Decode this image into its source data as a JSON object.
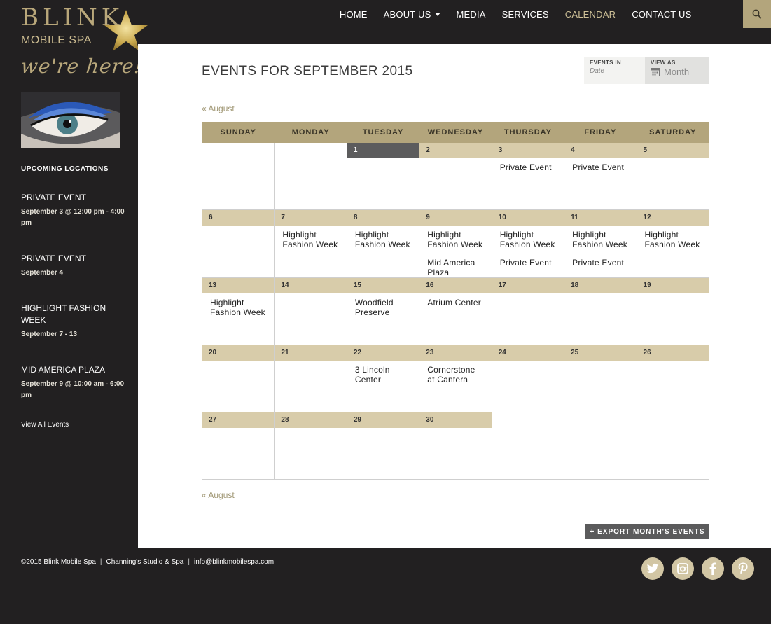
{
  "brand": {
    "logo_word": "BLINK",
    "logo_sub": "MOBILE SPA",
    "tagline": "we're here!"
  },
  "nav": {
    "items": [
      {
        "label": "HOME"
      },
      {
        "label": "ABOUT US"
      },
      {
        "label": "MEDIA"
      },
      {
        "label": "SERVICES"
      },
      {
        "label": "CALENDAR"
      },
      {
        "label": "CONTACT US"
      }
    ]
  },
  "sidebar": {
    "section_title": "UPCOMING LOCATIONS",
    "events": [
      {
        "title": "PRIVATE EVENT",
        "date": "September 3 @ 12:00 pm - 4:00 pm"
      },
      {
        "title": "PRIVATE EVENT",
        "date": "September 4"
      },
      {
        "title": "HIGHLIGHT FASHION WEEK",
        "date": "September 7 - 13"
      },
      {
        "title": "MID AMERICA PLAZA",
        "date": "September 9 @ 10:00 am - 6:00 pm"
      }
    ],
    "view_all": "View All Events"
  },
  "main": {
    "title": "EVENTS FOR SEPTEMBER 2015",
    "events_in_label": "EVENTS IN",
    "events_in_placeholder": "Date",
    "view_as_label": "VIEW AS",
    "view_as_value": "Month",
    "prev_month": "« August",
    "export_label": "+ EXPORT MONTH'S EVENTS"
  },
  "calendar": {
    "weekdays": [
      "SUNDAY",
      "MONDAY",
      "TUESDAY",
      "WEDNESDAY",
      "THURSDAY",
      "FRIDAY",
      "SATURDAY"
    ],
    "weeks": [
      [
        {
          "day": "",
          "events": []
        },
        {
          "day": "",
          "events": []
        },
        {
          "day": "1",
          "today": true,
          "events": []
        },
        {
          "day": "2",
          "events": []
        },
        {
          "day": "3",
          "events": [
            "Private Event"
          ]
        },
        {
          "day": "4",
          "events": [
            "Private Event"
          ]
        },
        {
          "day": "5",
          "events": []
        }
      ],
      [
        {
          "day": "6",
          "events": []
        },
        {
          "day": "7",
          "events": [
            "Highlight Fashion Week"
          ]
        },
        {
          "day": "8",
          "events": [
            "Highlight Fashion Week"
          ]
        },
        {
          "day": "9",
          "events": [
            "Highlight Fashion Week",
            "Mid America Plaza"
          ]
        },
        {
          "day": "10",
          "events": [
            "Highlight Fashion Week",
            "Private Event"
          ]
        },
        {
          "day": "11",
          "events": [
            "Highlight Fashion Week",
            "Private Event"
          ]
        },
        {
          "day": "12",
          "events": [
            "Highlight Fashion Week"
          ]
        }
      ],
      [
        {
          "day": "13",
          "events": [
            "Highlight Fashion Week"
          ]
        },
        {
          "day": "14",
          "events": []
        },
        {
          "day": "15",
          "events": [
            "Woodfield Preserve"
          ]
        },
        {
          "day": "16",
          "events": [
            "Atrium Center"
          ]
        },
        {
          "day": "17",
          "events": []
        },
        {
          "day": "18",
          "events": []
        },
        {
          "day": "19",
          "events": []
        }
      ],
      [
        {
          "day": "20",
          "events": []
        },
        {
          "day": "21",
          "events": []
        },
        {
          "day": "22",
          "events": [
            "3 Lincoln Center"
          ]
        },
        {
          "day": "23",
          "events": [
            "Cornerstone at Cantera"
          ]
        },
        {
          "day": "24",
          "events": []
        },
        {
          "day": "25",
          "events": []
        },
        {
          "day": "26",
          "events": []
        }
      ],
      [
        {
          "day": "27",
          "events": []
        },
        {
          "day": "28",
          "events": []
        },
        {
          "day": "29",
          "events": []
        },
        {
          "day": "30",
          "events": []
        },
        {
          "day": "",
          "events": []
        },
        {
          "day": "",
          "events": []
        },
        {
          "day": "",
          "events": []
        }
      ]
    ]
  },
  "footer": {
    "copyright": "©2015 Blink Mobile Spa",
    "studio": "Channing's Studio & Spa",
    "email": "info@blinkmobilespa.com",
    "separator": "|",
    "social": [
      "twitter-icon",
      "instagram-icon",
      "facebook-icon",
      "pinterest-icon"
    ]
  },
  "colors": {
    "gold": "#b3a57c",
    "gold_light": "#d8ccaa",
    "dark": "#222021",
    "today": "#5c5c5d"
  }
}
